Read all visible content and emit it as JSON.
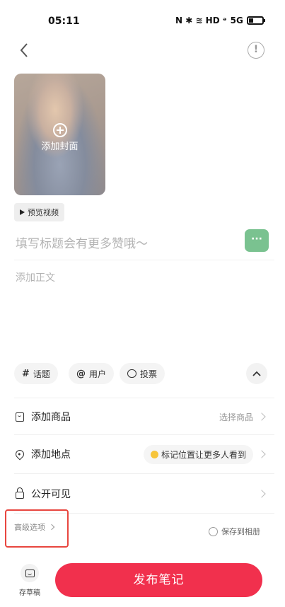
{
  "status_bar": {
    "time": "05:11",
    "icons": [
      "nfc-icon",
      "bluetooth-icon",
      "wifi-icon",
      "hd-icon",
      "signal-icon",
      "battery-icon"
    ],
    "indicators_text": "N ✱ ≋ HD ᵊ",
    "signal_text": "5G"
  },
  "header": {
    "back_icon": "chevron-left-icon",
    "info_label": "!"
  },
  "cover": {
    "add_cover_label": "添加封面"
  },
  "preview": {
    "label": "预览视频"
  },
  "editor": {
    "title_placeholder": "填写标题会有更多赞哦～",
    "body_placeholder": "添加正文",
    "emoji_label": "···"
  },
  "chips": {
    "topic": {
      "icon": "#",
      "label": "话题"
    },
    "user": {
      "icon": "@",
      "label": "用户"
    },
    "vote": {
      "label": "投票"
    },
    "collapse_label": "^"
  },
  "rows": {
    "product": {
      "label": "添加商品",
      "right": "选择商品"
    },
    "location": {
      "label": "添加地点",
      "hint": "标记位置让更多人看到"
    },
    "visibility": {
      "label": "公开可见"
    }
  },
  "advanced": {
    "label": "高级选项",
    "save_album": "保存到相册"
  },
  "bottom": {
    "draft_label": "存草稿",
    "publish_label": "发布笔记"
  },
  "colors": {
    "publish": "#f1304d",
    "emoji_button": "#7ac290",
    "highlight": "#e8463f"
  }
}
